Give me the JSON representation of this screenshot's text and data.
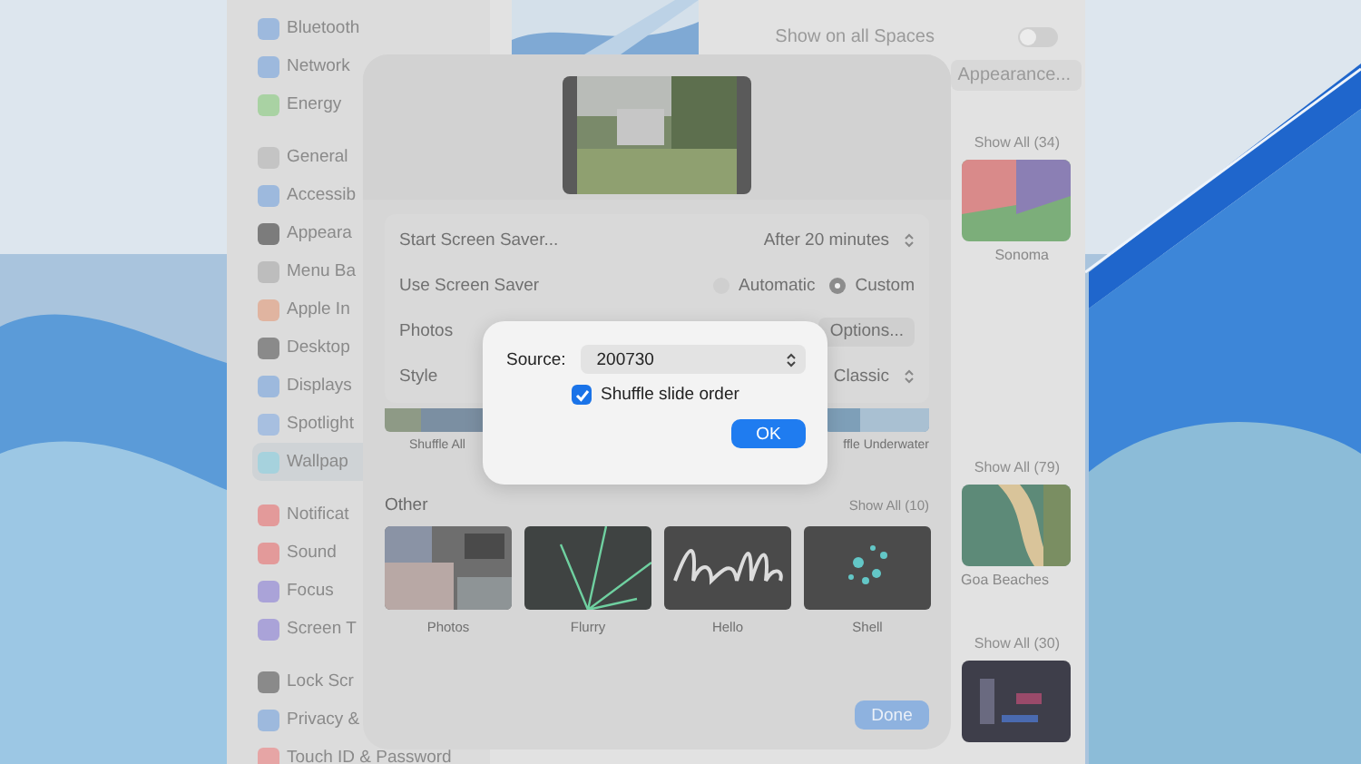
{
  "sidebar": {
    "groups": [
      {
        "items": [
          {
            "label": "Bluetooth",
            "selected": false,
            "color": "#9db9dd"
          },
          {
            "label": "Network",
            "selected": false,
            "color": "#9db9dd"
          },
          {
            "label": "Energy",
            "selected": false,
            "color": "#a9d2a3"
          }
        ]
      },
      {
        "items": [
          {
            "label": "General",
            "selected": false,
            "color": "#c4c4c4"
          },
          {
            "label": "Accessib",
            "selected": false,
            "color": "#9db9dd"
          },
          {
            "label": "Appeara",
            "selected": false,
            "color": "#7c7c7c"
          },
          {
            "label": "Menu Ba",
            "selected": false,
            "color": "#bdbdbd"
          },
          {
            "label": "Apple In",
            "selected": false,
            "color": "#e0b4a0"
          },
          {
            "label": "Desktop",
            "selected": false,
            "color": "#8a8a8a"
          },
          {
            "label": "Displays",
            "selected": false,
            "color": "#9db9dd"
          },
          {
            "label": "Spotlight",
            "selected": false,
            "color": "#a7bfe0"
          },
          {
            "label": "Wallpap",
            "selected": true,
            "color": "#a6d2dd"
          }
        ]
      },
      {
        "items": [
          {
            "label": "Notificat",
            "selected": false,
            "color": "#e39a9a"
          },
          {
            "label": "Sound",
            "selected": false,
            "color": "#e39a9a"
          },
          {
            "label": "Focus",
            "selected": false,
            "color": "#aaa3d8"
          },
          {
            "label": "Screen T",
            "selected": false,
            "color": "#aaa3d8"
          }
        ]
      },
      {
        "items": [
          {
            "label": "Lock Scr",
            "selected": false,
            "color": "#8a8a8a"
          },
          {
            "label": "Privacy &",
            "selected": false,
            "color": "#9db9dd"
          },
          {
            "label": "Touch ID & Password",
            "selected": false,
            "color": "#e6a5a5"
          }
        ]
      }
    ]
  },
  "wallpaper": {
    "spaces": {
      "label": "Show on all Spaces",
      "on": false
    },
    "appearance_button": "Appearance...",
    "sections": [
      {
        "show_all": "Show All (34)",
        "item": "Sonoma"
      },
      {
        "show_all": "Show All (79)",
        "item": "Goa Beaches"
      },
      {
        "show_all": "Show All (30)"
      }
    ]
  },
  "screen_saver_sheet": {
    "rows": [
      {
        "kind": "select",
        "label": "Start Screen Saver...",
        "value": "After 20 minutes"
      },
      {
        "kind": "radio",
        "label": "Use Screen Saver",
        "options": [
          {
            "label": "Automatic",
            "selected": false
          },
          {
            "label": "Custom",
            "selected": true
          }
        ]
      },
      {
        "kind": "button",
        "label": "Photos",
        "button": "Options..."
      },
      {
        "kind": "select",
        "label": "Style",
        "value": "Classic"
      }
    ],
    "shuffle": [
      "Shuffle All",
      "ffle Underwater"
    ],
    "other": {
      "title": "Other",
      "show_all": "Show All (10)",
      "items": [
        "Photos",
        "Flurry",
        "Hello",
        "Shell"
      ]
    },
    "done": "Done"
  },
  "options_dialog": {
    "source_label": "Source:",
    "source": "200730",
    "shuffle": {
      "label": "Shuffle slide order",
      "checked": true
    },
    "ok": "OK"
  }
}
